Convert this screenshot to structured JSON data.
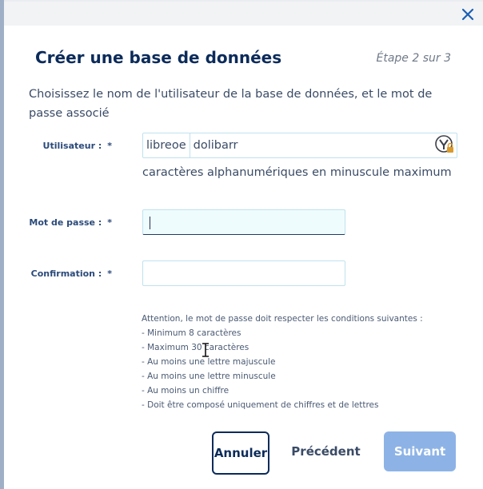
{
  "dialog": {
    "title": "Créer une base de données",
    "step": "Étape 2 sur 3",
    "description": "Choisissez le nom de l'utilisateur de la base de données, et le mot de passe associé"
  },
  "form": {
    "user": {
      "label": "Utilisateur :",
      "required": "*",
      "prefix": "libreoe",
      "value": "dolibarr",
      "hint": "caractères alphanumériques en minuscule maximum"
    },
    "password": {
      "label": "Mot de passe :",
      "required": "*",
      "value": ""
    },
    "confirmation": {
      "label": "Confirmation :",
      "required": "*",
      "value": ""
    }
  },
  "rules": {
    "intro": "Attention, le mot de passe doit respecter les conditions suivantes :",
    "items": [
      "- Minimum 8 caractères",
      "- Maximum 30 caractères",
      "- Au moins une lettre majuscule",
      "- Au moins une lettre minuscule",
      "- Au moins un chiffre",
      "- Doit être composé uniquement de chiffres et de lettres"
    ]
  },
  "buttons": {
    "cancel": "Annuler",
    "previous": "Précédent",
    "next": "Suivant"
  },
  "icons": {
    "close": "close-icon",
    "lock": "password-manager-lock-icon",
    "cursor": "text-cursor-icon"
  },
  "colors": {
    "primary": "#0b2b5a",
    "next_disabled": "#8db3e6",
    "field_border": "#bfe2ee"
  }
}
